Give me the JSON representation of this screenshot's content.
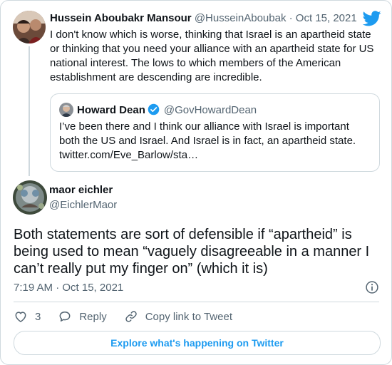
{
  "parent_tweet": {
    "author_name": "Hussein Aboubakr Mansour",
    "author_handle": "@HusseinAboubak",
    "separator": "·",
    "date": "Oct 15, 2021",
    "text": "I don't know which is worse, thinking that Israel is an apartheid state or thinking that you need your alliance with an apartheid state for US national interest. The lows to which members of the American establishment are descending are incredible."
  },
  "quoted_tweet": {
    "author_name": "Howard Dean",
    "author_handle": "@GovHowardDean",
    "verified": true,
    "text": "I’ve been there and I think our alliance with Israel is important both the US and Israel. And Israel is in fact, an apartheid state. twitter.com/Eve_Barlow/sta…"
  },
  "main_tweet": {
    "author_name": "maor eichler",
    "author_handle": "@EichlerMaor",
    "text": "Both statements are sort of defensible if “apartheid” is being used to mean “vaguely disagreeable in a manner I can’t really put my finger on” (which it is)",
    "timestamp": "7:19 AM · Oct 15, 2021"
  },
  "actions": {
    "like_count": "3",
    "reply_label": "Reply",
    "copy_link_label": "Copy link to Tweet"
  },
  "explore_label": "Explore what's happening on Twitter",
  "icons": {
    "brand": "twitter-bird-icon",
    "verified": "verified-badge-icon",
    "info": "info-icon",
    "like": "heart-icon",
    "reply": "reply-bubble-icon",
    "link": "link-icon"
  },
  "colors": {
    "brand_blue": "#1d9bf0",
    "text_primary": "#0f1419",
    "text_secondary": "#536471",
    "border": "#cfd9de"
  }
}
